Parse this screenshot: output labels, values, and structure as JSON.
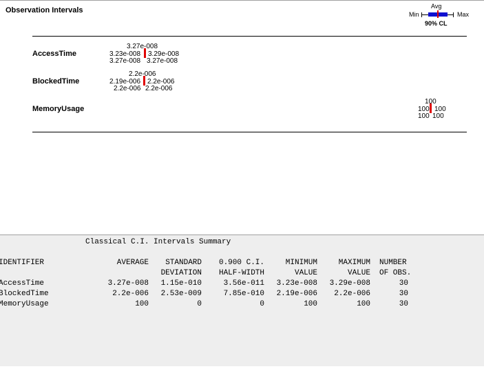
{
  "plot": {
    "title": "Observation Intervals",
    "legend": {
      "avg": "Avg",
      "min": "Min",
      "max": "Max",
      "cl": "90% CL"
    },
    "rows": [
      {
        "label": "AccessTime",
        "top": "3.27e-008",
        "left": "3.23e-008",
        "right": "3.29e-008",
        "bottom_left": "3.27e-008",
        "bottom_right": "3.27e-008"
      },
      {
        "label": "BlockedTime",
        "top": "2.2e-006",
        "left": "2.19e-006",
        "right": "2.2e-006",
        "bottom_left": "2.2e-006",
        "bottom_right": "2.2e-006"
      },
      {
        "label": "MemoryUsage",
        "top": "100",
        "left": "100",
        "right": "100",
        "bottom_left": "100",
        "bottom_right": "100"
      }
    ]
  },
  "summary": {
    "title": "Classical C.I. Intervals Summary",
    "headers": [
      [
        "IDENTIFIER",
        ""
      ],
      [
        "AVERAGE",
        ""
      ],
      [
        "STANDARD",
        "DEVIATION"
      ],
      [
        "0.900 C.I.",
        "HALF-WIDTH"
      ],
      [
        "MINIMUM",
        "VALUE"
      ],
      [
        "MAXIMUM",
        "VALUE"
      ],
      [
        "NUMBER",
        "OF OBS."
      ]
    ],
    "rows": [
      [
        "AccessTime",
        "3.27e-008",
        "1.15e-010",
        "3.56e-011",
        "3.23e-008",
        "3.29e-008",
        "30"
      ],
      [
        "BlockedTime",
        "2.2e-006",
        "2.53e-009",
        "7.85e-010",
        "2.19e-006",
        "2.2e-006",
        "30"
      ],
      [
        "MemoryUsage",
        "100",
        "0",
        "0",
        "100",
        "100",
        "30"
      ]
    ]
  }
}
